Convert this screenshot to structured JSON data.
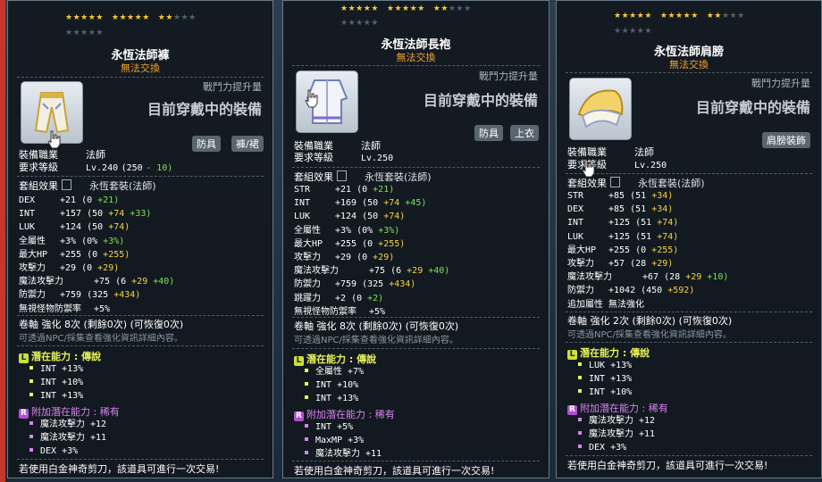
{
  "panels": [
    {
      "stars_on": 12,
      "stars_total": 20,
      "name": "永恆法師褲",
      "trade": "無法交換",
      "boost": "戰鬥力提升量",
      "wearing": "目前穿戴中的裝備",
      "tags": [
        "防具",
        "褲/裙"
      ],
      "job_label": "裝備職業",
      "job": "法師",
      "level_label": "要求等級",
      "level": "Lv.240",
      "level_extra_a": "(250",
      "level_extra_b": "- 10)",
      "set_label": "套組效果",
      "set_name": "永恆套裝(法師)",
      "stats": [
        {
          "k": "DEX",
          "v": "+21",
          "p": "(0",
          "a": "",
          "b": "+21)"
        },
        {
          "k": "INT",
          "v": "+157",
          "p": "(50",
          "a": "+74",
          "b": "+33)"
        },
        {
          "k": "LUK",
          "v": "+124",
          "p": "(50",
          "a": "+74)",
          "b": ""
        },
        {
          "k": "全屬性",
          "v": "+3%",
          "p": "(0%",
          "a": "",
          "b": "+3%)"
        },
        {
          "k": "最大HP",
          "v": "+255",
          "p": "(0",
          "a": "+255)",
          "b": ""
        },
        {
          "k": "攻擊力",
          "v": "+29",
          "p": "(0",
          "a": "+29)",
          "b": ""
        },
        {
          "k": "魔法攻擊力",
          "v": "+75",
          "p": "(6",
          "a": "+29",
          "b": "+40)"
        },
        {
          "k": "防禦力",
          "v": "+759",
          "p": "(325",
          "a": "+434)",
          "b": ""
        },
        {
          "k": "無視怪物防禦率",
          "v": "+5%",
          "p": "",
          "a": "",
          "b": ""
        }
      ],
      "scroll": "卷軸 強化 8次 (剩餘0次) (可恢復0次)",
      "note": "可透過NPC/採集查看強化資訊詳細內容。",
      "pot_label": "潛在能力",
      "pot_rank": "傳說",
      "pots": [
        "INT +13%",
        "INT +10%",
        "INT +13%"
      ],
      "add_label": "附加潛在能力",
      "add_rank": "稀有",
      "adds": [
        "魔法攻擊力 +12",
        "魔法攻擊力 +11",
        "DEX +3%"
      ],
      "footer": "若使用白金神奇剪刀，該道具可進行一次交易!"
    },
    {
      "stars_on": 12,
      "stars_total": 20,
      "name": "永恆法師長袍",
      "trade": "無法交換",
      "boost": "戰鬥力提升量",
      "wearing": "目前穿戴中的裝備",
      "tags": [
        "防具",
        "上衣"
      ],
      "job_label": "裝備職業",
      "job": "法師",
      "level_label": "要求等級",
      "level": "Lv.250",
      "level_extra_a": "",
      "level_extra_b": "",
      "set_label": "套組效果",
      "set_name": "永恆套裝(法師)",
      "stats": [
        {
          "k": "STR",
          "v": "+21",
          "p": "(0",
          "a": "",
          "b": "+21)"
        },
        {
          "k": "INT",
          "v": "+169",
          "p": "(50",
          "a": "+74",
          "b": "+45)"
        },
        {
          "k": "LUK",
          "v": "+124",
          "p": "(50",
          "a": "+74)",
          "b": ""
        },
        {
          "k": "全屬性",
          "v": "+3%",
          "p": "(0%",
          "a": "",
          "b": "+3%)"
        },
        {
          "k": "最大HP",
          "v": "+255",
          "p": "(0",
          "a": "+255)",
          "b": ""
        },
        {
          "k": "攻擊力",
          "v": "+29",
          "p": "(0",
          "a": "+29)",
          "b": ""
        },
        {
          "k": "魔法攻擊力",
          "v": "+75",
          "p": "(6",
          "a": "+29",
          "b": "+40)"
        },
        {
          "k": "防禦力",
          "v": "+759",
          "p": "(325",
          "a": "+434)",
          "b": ""
        },
        {
          "k": "跳躍力",
          "v": "+2",
          "p": "(0",
          "a": "",
          "b": "+2)"
        },
        {
          "k": "無視怪物防禦率",
          "v": "+5%",
          "p": "",
          "a": "",
          "b": ""
        }
      ],
      "scroll": "卷軸 強化 8次 (剩餘0次) (可恢復0次)",
      "note": "可透過NPC/採集查看強化資訊詳細內容。",
      "pot_label": "潛在能力",
      "pot_rank": "傳說",
      "pots": [
        "全屬性 +7%",
        "INT +10%",
        "INT +13%"
      ],
      "add_label": "附加潛在能力",
      "add_rank": "稀有",
      "adds": [
        "INT +5%",
        "MaxMP +3%",
        "魔法攻擊力 +11"
      ],
      "footer": "若使用白金神奇剪刀，該道具可進行一次交易!"
    },
    {
      "stars_on": 12,
      "stars_total": 20,
      "name": "永恆法師肩膀",
      "trade": "無法交換",
      "boost": "戰鬥力提升量",
      "wearing": "目前穿戴中的裝備",
      "tags": [
        "肩膀裝飾"
      ],
      "job_label": "裝備職業",
      "job": "法師",
      "level_label": "要求等級",
      "level": "Lv.250",
      "level_extra_a": "",
      "level_extra_b": "",
      "set_label": "套組效果",
      "set_name": "永恆套裝(法師)",
      "stats": [
        {
          "k": "STR",
          "v": "+85",
          "p": "(51",
          "a": "+34)",
          "b": ""
        },
        {
          "k": "DEX",
          "v": "+85",
          "p": "(51",
          "a": "+34)",
          "b": ""
        },
        {
          "k": "INT",
          "v": "+125",
          "p": "(51",
          "a": "+74)",
          "b": ""
        },
        {
          "k": "LUK",
          "v": "+125",
          "p": "(51",
          "a": "+74)",
          "b": ""
        },
        {
          "k": "最大HP",
          "v": "+255",
          "p": "(0",
          "a": "+255)",
          "b": ""
        },
        {
          "k": "攻擊力",
          "v": "+57",
          "p": "(28",
          "a": "+29)",
          "b": ""
        },
        {
          "k": "魔法攻擊力",
          "v": "+67",
          "p": "(28",
          "a": "+29",
          "b": "+10)"
        },
        {
          "k": "防禦力",
          "v": "+1042",
          "p": "(450",
          "a": "+592)",
          "b": ""
        },
        {
          "k": "追加屬性",
          "v": "無法強化",
          "p": "",
          "a": "",
          "b": ""
        }
      ],
      "scroll": "卷軸 強化 2次 (剩餘0次) (可恢復0次)",
      "note": "可透過NPC/採集查看強化資訊詳細內容。",
      "pot_label": "潛在能力",
      "pot_rank": "傳說",
      "pots": [
        "LUK +13%",
        "INT +13%",
        "INT +10%"
      ],
      "add_label": "附加潛在能力",
      "add_rank": "稀有",
      "adds": [
        "魔法攻擊力 +12",
        "魔法攻擊力 +11",
        "DEX +3%"
      ],
      "footer": "若使用白金神奇剪刀，該道具可進行一次交易!"
    }
  ]
}
